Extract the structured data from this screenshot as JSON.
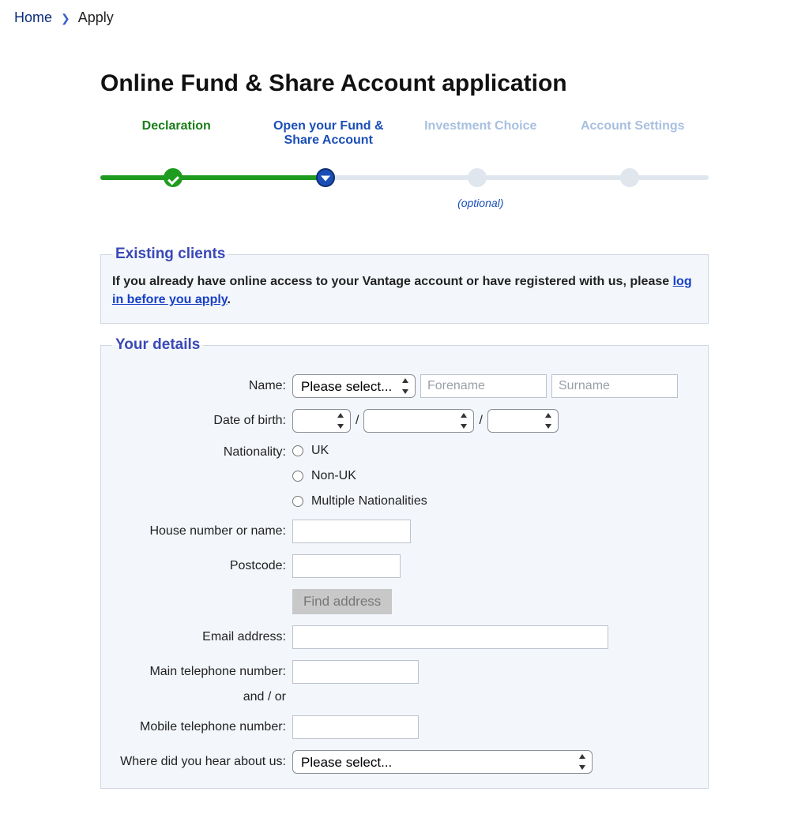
{
  "breadcrumb": {
    "home": "Home",
    "current": "Apply"
  },
  "page_title": "Online Fund & Share Account application",
  "stepper": {
    "step1": "Declaration",
    "step2": "Open your Fund & Share Account",
    "step3": "Investment Choice",
    "step4": "Account Settings",
    "optional": "(optional)"
  },
  "existing": {
    "legend": "Existing clients",
    "text_before": "If you already have online access to your Vantage account or have registered with us, please ",
    "link": "log in before you apply",
    "text_after": "."
  },
  "details": {
    "legend": "Your details",
    "name_label": "Name:",
    "title_select": "Please select...",
    "forename_ph": "Forename",
    "surname_ph": "Surname",
    "dob_label": "Date of birth:",
    "slash": "/",
    "nationality_label": "Nationality:",
    "nat_uk": "UK",
    "nat_nonuk": "Non-UK",
    "nat_multi": "Multiple Nationalities",
    "house_label": "House number or name:",
    "postcode_label": "Postcode:",
    "find_address": "Find address",
    "email_label": "Email address:",
    "main_tel_label": "Main telephone number:",
    "and_or": "and / or",
    "mobile_tel_label": "Mobile telephone number:",
    "hear_label": "Where did you hear about us:",
    "hear_select": "Please select..."
  }
}
